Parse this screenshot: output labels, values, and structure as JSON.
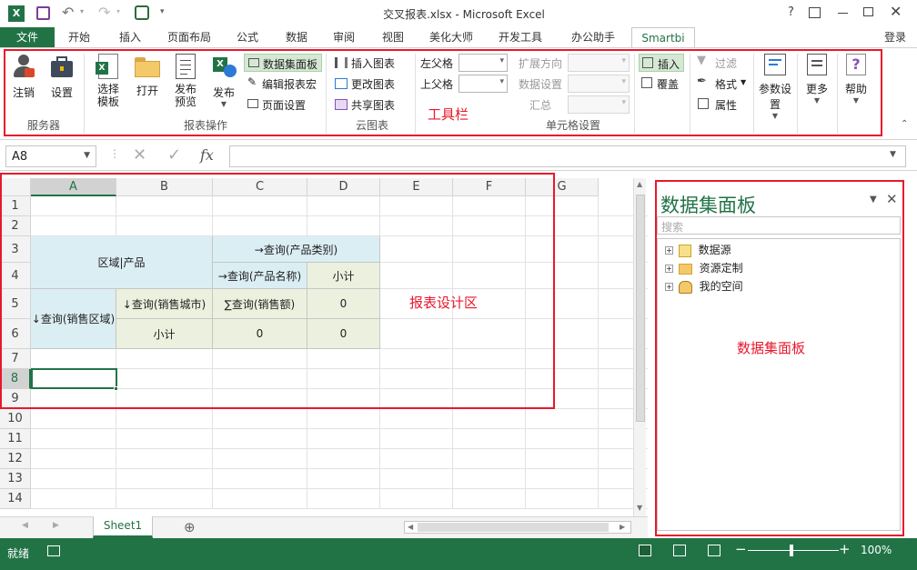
{
  "window": {
    "title": "交叉报表.xlsx - Microsoft Excel",
    "help": "?",
    "signin": "登录"
  },
  "tabs": [
    "文件",
    "开始",
    "插入",
    "页面布局",
    "公式",
    "数据",
    "审阅",
    "视图",
    "美化大师",
    "开发工具",
    "办公助手",
    "Smartbi"
  ],
  "ribbon": {
    "login": "注销",
    "settings": "设置",
    "server_group": "服务器",
    "select_template_1": "选择",
    "select_template_2": "模板",
    "open": "打开",
    "publish_preview_1": "发布",
    "publish_preview_2": "预览",
    "publish": "发布",
    "dataset_panel": "数据集面板",
    "edit_macro": "编辑报表宏",
    "page_setup": "页面设置",
    "report_group": "报表操作",
    "insert_chart": "插入图表",
    "change_chart": "更改图表",
    "share_chart": "共享图表",
    "cloud_group": "云图表",
    "toolbar_annotation": "工具栏",
    "left_parent": "左父格",
    "top_parent": "上父格",
    "expand_dir": "扩展方向",
    "data_setting": "数据设置",
    "summary": "汇总",
    "cell_group": "单元格设置",
    "insert": "插入",
    "overwrite": "覆盖",
    "filter": "过滤",
    "format": "格式",
    "property": "属性",
    "param_settings": "参数设置",
    "more": "更多",
    "help": "帮助"
  },
  "formula": {
    "namebox": "A8",
    "fx": "fx"
  },
  "columns": [
    "A",
    "B",
    "C",
    "D",
    "E",
    "F",
    "G"
  ],
  "rows": [
    "1",
    "2",
    "3",
    "4",
    "5",
    "6",
    "7",
    "8",
    "9",
    "10",
    "11",
    "12",
    "13",
    "14"
  ],
  "cells": {
    "a3": "区域|产品",
    "c3": "→查询(产品类别)",
    "c4": "→查询(产品名称)",
    "d4": "小计",
    "a5": "↓查询(销售区域)",
    "b5": "↓查询(销售城市)",
    "c5": "∑查询(销售额)",
    "d5": "0",
    "b6": "小计",
    "c6": "0",
    "d6": "0"
  },
  "report_design_annotation": "报表设计区",
  "sheet": {
    "tab": "Sheet1",
    "add": "⊕"
  },
  "status": {
    "ready": "就绪",
    "zoom": "100%"
  },
  "panel": {
    "title": "数据集面板",
    "search_placeholder": "搜索",
    "tree": [
      "数据源",
      "资源定制",
      "我的空间"
    ],
    "annotation": "数据集面板"
  },
  "colors": {
    "excel_green": "#217346",
    "header_blue": "#dbeef4",
    "row_green": "#ebf1de",
    "annotation_red": "#e8182c"
  }
}
